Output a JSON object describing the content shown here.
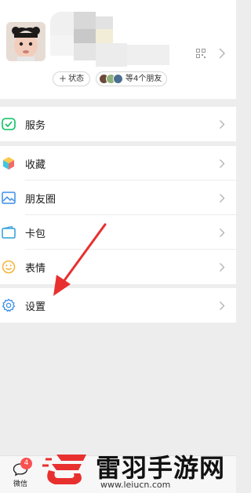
{
  "profile": {
    "status_label": "状态",
    "friends_label": "等4个朋友"
  },
  "menu": {
    "services": {
      "label": "服务",
      "icon": "services-icon"
    },
    "favorites": {
      "label": "收藏",
      "icon": "favorites-cube-icon"
    },
    "moments": {
      "label": "朋友圈",
      "icon": "moments-image-icon"
    },
    "cards": {
      "label": "卡包",
      "icon": "card-wallet-icon"
    },
    "stickers": {
      "label": "表情",
      "icon": "smiley-icon"
    },
    "settings": {
      "label": "设置",
      "icon": "gear-icon"
    }
  },
  "tabbar": {
    "wechat": {
      "label": "微信",
      "badge": "4"
    }
  },
  "watermark": {
    "title": "雷羽手游网",
    "url": "www.leiucn.com"
  },
  "colors": {
    "accent_green": "#07c160",
    "badge_red": "#fa5151",
    "arrow_red": "#e8302f",
    "background": "#ededed"
  }
}
